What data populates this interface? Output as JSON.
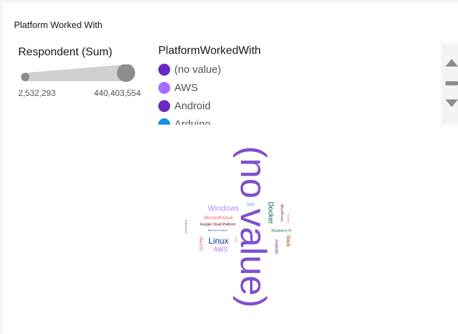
{
  "card": {
    "title": "Platform Worked With"
  },
  "size_legend": {
    "title": "Respondent (Sum)",
    "min_label": "2,532,293",
    "max_label": "440,403,554",
    "color": "#8d8d8d"
  },
  "color_legend": {
    "title": "PlatformWorkedWith",
    "items": [
      {
        "label": "(no value)",
        "color": "#6929c4"
      },
      {
        "label": "AWS",
        "color": "#a56eff"
      },
      {
        "label": "Android",
        "color": "#6929c4"
      },
      {
        "label": "Arduino",
        "color": "#1192e8"
      }
    ]
  },
  "chart_data": {
    "type": "word-cloud",
    "words": [
      {
        "text": "(no value)",
        "color": "#7d4fcf",
        "size": 52,
        "rotate": 90
      },
      {
        "text": "Windows",
        "color": "#b38cf0",
        "size": 11,
        "rotate": 0
      },
      {
        "text": "iOS",
        "color": "#4589ff",
        "size": 6,
        "rotate": 0
      },
      {
        "text": "Docker",
        "color": "#005d5d",
        "size": 10,
        "rotate": 90
      },
      {
        "text": "WordPress",
        "color": "#9f1853",
        "size": 5,
        "rotate": 90
      },
      {
        "text": "Heroku",
        "color": "#ee5396",
        "size": 4,
        "rotate": 90
      },
      {
        "text": "Microsoft Azure",
        "color": "#fa4d56",
        "size": 6,
        "rotate": 0
      },
      {
        "text": "Google Cloud Platform",
        "color": "#570408",
        "size": 5,
        "rotate": 0
      },
      {
        "text": "Raspberry Pi",
        "color": "#198038",
        "size": 5,
        "rotate": 0
      },
      {
        "text": "Kubernetes",
        "color": "#198038",
        "size": 4,
        "rotate": 90
      },
      {
        "text": "IBM Cloud or Watson",
        "color": "#002d9c",
        "size": 3,
        "rotate": 0
      },
      {
        "text": "Linux",
        "color": "#002d9c",
        "size": 12,
        "rotate": 0
      },
      {
        "text": "Slack",
        "color": "#8a3800",
        "size": 7,
        "rotate": 90
      },
      {
        "text": "Android",
        "color": "#6929c4",
        "size": 6,
        "rotate": 90
      },
      {
        "text": "MacOS",
        "color": "#ee5396",
        "size": 6,
        "rotate": 90
      },
      {
        "text": "AWS",
        "color": "#a56eff",
        "size": 9,
        "rotate": 0
      },
      {
        "text": "Arduino",
        "color": "#1192e8",
        "size": 4,
        "rotate": 0
      },
      {
        "text": "Drupal",
        "color": "#b28600",
        "size": 3,
        "rotate": 90
      }
    ]
  }
}
